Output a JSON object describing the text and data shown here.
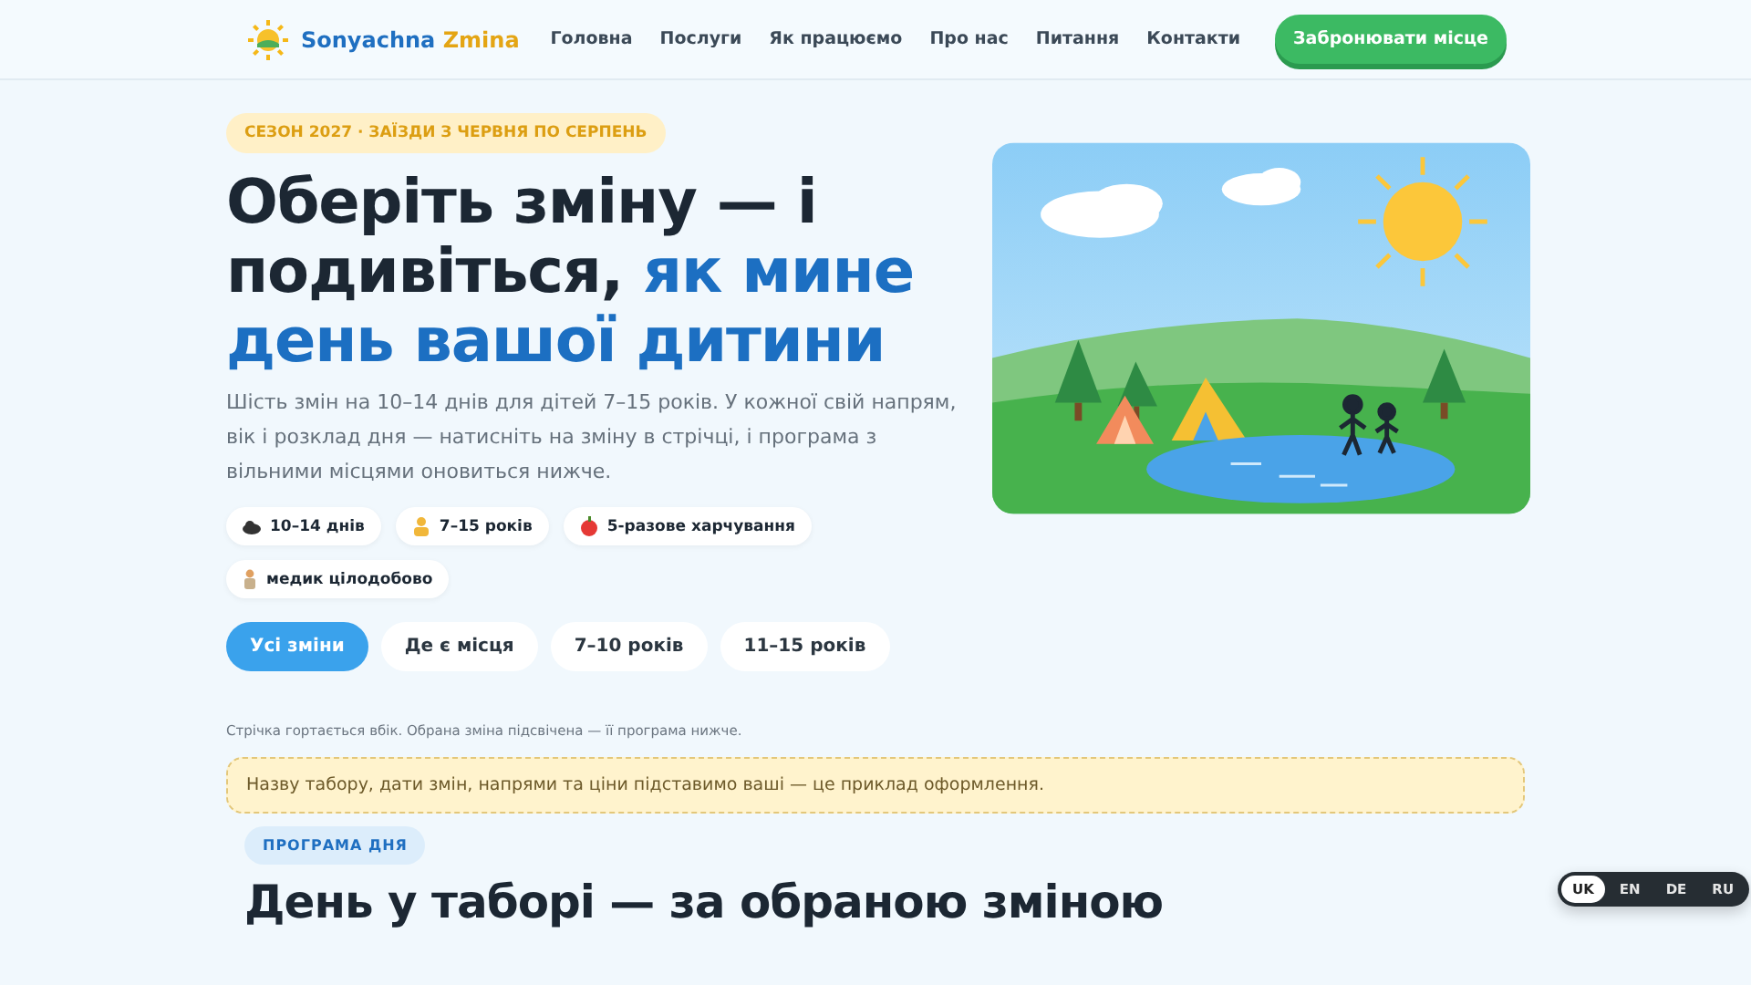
{
  "header": {
    "logo": {
      "part_1": "Sonyachna",
      "part_2": "Zmina"
    },
    "nav": [
      "Головна",
      "Послуги",
      "Як працюємо",
      "Про нас",
      "Питання",
      "Контакти"
    ],
    "cta": "Забронювати місце"
  },
  "hero": {
    "badge": "СЕЗОН 2027 · ЗАЇЗДИ З ЧЕРВНЯ ПО СЕРПЕНЬ",
    "heading": [
      {
        "text": "Оберіть зміну — і подивіться,",
        "accent": false
      },
      {
        "text": "як мине день вашої дитини",
        "accent": true
      }
    ],
    "lead": "Шість змін на 10–14 днів для дітей 7–15 років. У кожної свій напрям, вік і розклад дня — натисніть на зміну в стрічці, і програма з вільними місцями оновиться нижче.",
    "chips": [
      {
        "kind": "days",
        "label": "10–14 днів"
      },
      {
        "kind": "age",
        "label": "7–15 років"
      },
      {
        "kind": "food",
        "label": "5-разове харчування"
      },
      {
        "kind": "medic",
        "label": "медик цілодобово"
      }
    ],
    "filters": [
      {
        "label": "Усі зміни",
        "selected": true
      },
      {
        "label": "Де є місця",
        "selected": false
      },
      {
        "label": "7–10 років",
        "selected": false
      },
      {
        "label": "11–15 років",
        "selected": false
      }
    ]
  },
  "hint": "Стрічка гортається вбік. Обрана зміна підсвічена — її програма нижче.",
  "notice": "Назву табору, дати змін, напрями та ціни підставимо ваші — це приклад оформлення.",
  "program": {
    "eyebrow": "ПРОГРАМА ДНЯ",
    "title": "День у таборі — за обраною зміною"
  },
  "languages": [
    {
      "code": "UK",
      "selected": true
    },
    {
      "code": "EN",
      "selected": false
    },
    {
      "code": "DE",
      "selected": false
    },
    {
      "code": "RU",
      "selected": false
    }
  ]
}
